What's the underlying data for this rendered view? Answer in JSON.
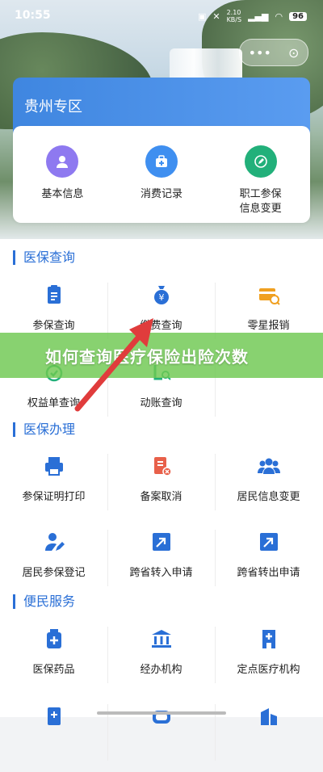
{
  "status": {
    "time": "10:55",
    "net": "2.10\nKB/S",
    "battery": "96"
  },
  "capsule": {
    "more": "•••",
    "close": "⊙"
  },
  "region": {
    "title": "贵州专区"
  },
  "top_actions": [
    {
      "label": "基本信息",
      "color": "#8e79f0",
      "icon": "person-icon"
    },
    {
      "label": "消费记录",
      "color": "#3f8ff0",
      "icon": "medical-kit-icon"
    },
    {
      "label": "职工参保\n信息变更",
      "color": "#22b07a",
      "icon": "edit-icon"
    }
  ],
  "sections": [
    {
      "title": "医保查询",
      "rows": [
        [
          {
            "label": "参保查询",
            "icon": "clipboard-icon"
          },
          {
            "label": "缴费查询",
            "icon": "money-bag-icon"
          },
          {
            "label": "零星报销",
            "icon": "card-search-icon"
          }
        ],
        [
          {
            "label": "权益单查询",
            "icon": "rights-icon"
          },
          {
            "label": "动账查询",
            "icon": "account-search-icon"
          },
          {
            "label": "",
            "icon": ""
          }
        ]
      ]
    },
    {
      "title": "医保办理",
      "rows": [
        [
          {
            "label": "参保证明打印",
            "icon": "printer-icon"
          },
          {
            "label": "备案取消",
            "icon": "cancel-doc-icon"
          },
          {
            "label": "居民信息变更",
            "icon": "group-icon"
          }
        ],
        [
          {
            "label": "居民参保登记",
            "icon": "user-edit-icon"
          },
          {
            "label": "跨省转入申请",
            "icon": "transfer-in-icon"
          },
          {
            "label": "跨省转出申请",
            "icon": "transfer-out-icon"
          }
        ]
      ]
    },
    {
      "title": "便民服务",
      "rows": [
        [
          {
            "label": "医保药品",
            "icon": "medicine-icon"
          },
          {
            "label": "经办机构",
            "icon": "institution-icon"
          },
          {
            "label": "定点医疗机构",
            "icon": "hospital-icon"
          }
        ]
      ]
    }
  ],
  "banner": {
    "text": "如何查询医疗保险出险次数"
  },
  "colors": {
    "primary": "#2a6fd6",
    "accent_orange": "#f0a020",
    "accent_red": "#e8604a",
    "banner_green": "#6ec850"
  }
}
